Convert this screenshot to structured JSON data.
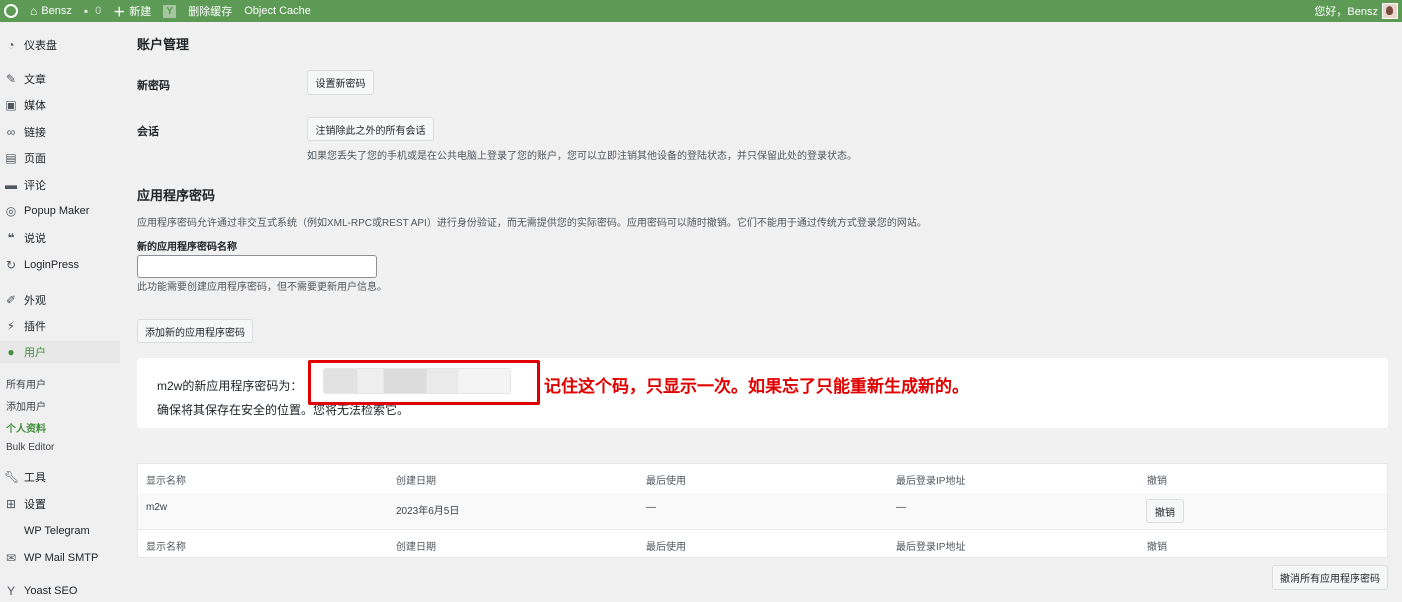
{
  "admin_bar": {
    "site_name": "Bensz",
    "comments_count": "0",
    "new_label": "新建",
    "clear_cache_label": "删除缓存",
    "object_cache_label": "Object Cache",
    "greeting": "您好，Bensz"
  },
  "sidebar": {
    "items": [
      {
        "label": "仪表盘",
        "icon": "dashboard-icon"
      },
      {
        "label": "文章",
        "icon": "pin-icon"
      },
      {
        "label": "媒体",
        "icon": "media-icon"
      },
      {
        "label": "链接",
        "icon": "link-icon"
      },
      {
        "label": "页面",
        "icon": "page-icon"
      },
      {
        "label": "评论",
        "icon": "comment-icon"
      },
      {
        "label": "Popup Maker",
        "icon": "popup-icon"
      },
      {
        "label": "说说",
        "icon": "quote-icon"
      },
      {
        "label": "LoginPress",
        "icon": "loginpress-icon"
      },
      {
        "label": "外观",
        "icon": "brush-icon"
      },
      {
        "label": "插件",
        "icon": "plugin-icon"
      },
      {
        "label": "用户",
        "icon": "user-icon"
      },
      {
        "label": "工具",
        "icon": "wrench-icon"
      },
      {
        "label": "设置",
        "icon": "settings-icon"
      },
      {
        "label": "WP Telegram",
        "icon": "telegram-icon"
      },
      {
        "label": "WP Mail SMTP",
        "icon": "mail-icon"
      },
      {
        "label": "Yoast SEO",
        "icon": "yoast-icon"
      }
    ],
    "users_submenu": [
      "所有用户",
      "添加用户",
      "个人资料",
      "Bulk Editor"
    ]
  },
  "account": {
    "title": "账户管理",
    "new_password_label": "新密码",
    "set_password_button": "设置新密码",
    "sessions_label": "会话",
    "logout_others_button": "注销除此之外的所有会话",
    "sessions_desc": "如果您丢失了您的手机或是在公共电脑上登录了您的账户，您可以立即注销其他设备的登陆状态，并只保留此处的登录状态。"
  },
  "app_passwords": {
    "title": "应用程序密码",
    "desc": "应用程序密码允许通过非交互式系统（例如XML-RPC或REST API）进行身份验证，而无需提供您的实际密码。应用密码可以随时撤销。它们不能用于通过传统方式登录您的网站。",
    "name_label": "新的应用程序密码名称",
    "name_value": "",
    "name_help": "此功能需要创建应用程序密码，但不需要更新用户信息。",
    "add_button": "添加新的应用程序密码",
    "notice_prefix": "m2w的新应用程序密码为：",
    "notice_line2": "确保将其保存在安全的位置。您将无法检索它。",
    "annotation": "记住这个码，只显示一次。如果忘了只能重新生成新的。",
    "table": {
      "headers": [
        "显示名称",
        "创建日期",
        "最后使用",
        "最后登录IP地址",
        "撤销"
      ],
      "rows": [
        {
          "name": "m2w",
          "created": "2023年6月5日",
          "last_used": "—",
          "last_ip": "—",
          "revoke": "撤销"
        }
      ]
    },
    "revoke_all_button": "撤消所有应用程序密码"
  },
  "colors": {
    "admin_bar": "#5c9a55",
    "active": "#3f8f3c",
    "annotation": "#e00000"
  }
}
